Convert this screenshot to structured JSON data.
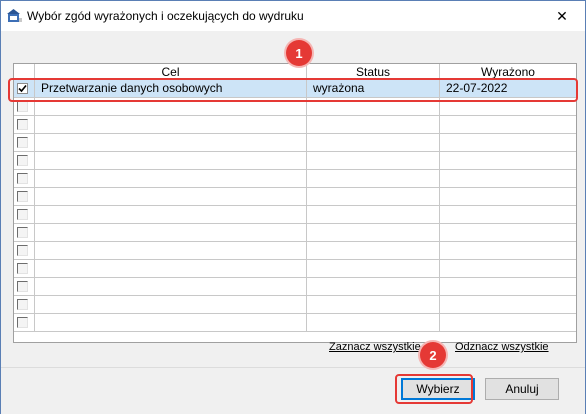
{
  "window": {
    "title": "Wybór zgód wyrażonych i oczekujących do wydruku",
    "close_glyph": "✕"
  },
  "grid": {
    "columns": [
      "",
      "Cel",
      "Status",
      "Wyrażono"
    ],
    "rows": [
      {
        "checked": true,
        "cel": "Przetwarzanie danych osobowych",
        "status": "wyrażona",
        "wyrazono": "22-07-2022",
        "selected": true
      },
      {
        "checked": false,
        "cel": "",
        "status": "",
        "wyrazono": ""
      },
      {
        "checked": false,
        "cel": "",
        "status": "",
        "wyrazono": ""
      },
      {
        "checked": false,
        "cel": "",
        "status": "",
        "wyrazono": ""
      },
      {
        "checked": false,
        "cel": "",
        "status": "",
        "wyrazono": ""
      },
      {
        "checked": false,
        "cel": "",
        "status": "",
        "wyrazono": ""
      },
      {
        "checked": false,
        "cel": "",
        "status": "",
        "wyrazono": ""
      },
      {
        "checked": false,
        "cel": "",
        "status": "",
        "wyrazono": ""
      },
      {
        "checked": false,
        "cel": "",
        "status": "",
        "wyrazono": ""
      },
      {
        "checked": false,
        "cel": "",
        "status": "",
        "wyrazono": ""
      },
      {
        "checked": false,
        "cel": "",
        "status": "",
        "wyrazono": ""
      },
      {
        "checked": false,
        "cel": "",
        "status": "",
        "wyrazono": ""
      },
      {
        "checked": false,
        "cel": "",
        "status": "",
        "wyrazono": ""
      },
      {
        "checked": false,
        "cel": "",
        "status": "",
        "wyrazono": ""
      }
    ]
  },
  "links": {
    "select_all": "Zaznacz wszystkie",
    "deselect_all": "Odznacz wszystkie"
  },
  "buttons": {
    "choose": "Wybierz",
    "cancel": "Anuluj"
  },
  "annotations": {
    "badge_1": "1",
    "badge_2": "2",
    "color": "#e53935"
  }
}
